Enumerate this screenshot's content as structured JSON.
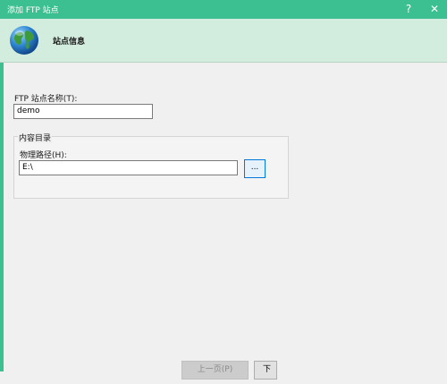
{
  "window": {
    "title": "添加 FTP 站点",
    "help_glyph": "?",
    "close_glyph": "✕"
  },
  "header": {
    "heading": "站点信息",
    "icon": "globe-icon"
  },
  "form": {
    "site_name_label": "FTP 站点名称(T):",
    "site_name_value": "demo",
    "content_group_label": "内容目录",
    "physical_path_label": "物理路径(H):",
    "physical_path_value": "E:\\",
    "browse_label": "..."
  },
  "footer": {
    "prev_label": "上一页(P)",
    "next_label": "下"
  },
  "colors": {
    "titlebar": "#3cbf91",
    "header": "#d2ecdd",
    "accent": "#0078d7"
  }
}
